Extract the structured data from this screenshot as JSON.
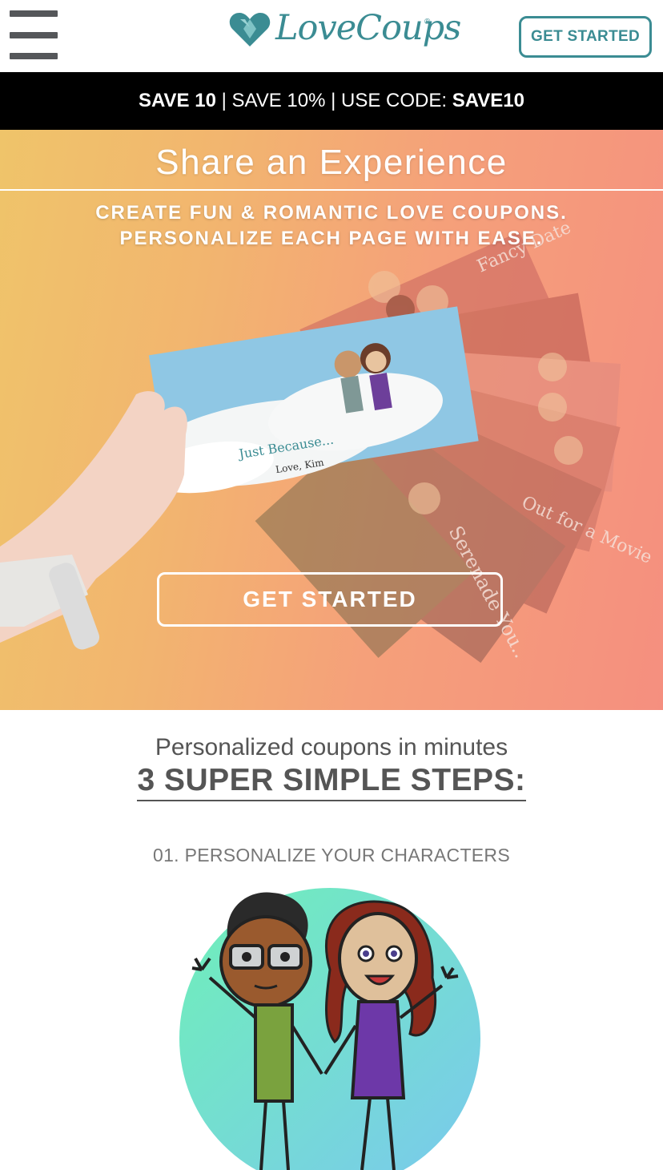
{
  "header": {
    "menu_icon": "hamburger-menu-icon",
    "logo_icon": "heart-logo-icon",
    "logo_text": "LoveCoups",
    "logo_reg": "®",
    "cta_label": "GET STARTED",
    "brand_color": "#3b8c93"
  },
  "promo": {
    "part1": "SAVE 10",
    "sep1": " | SAVE 10% | USE CODE: ",
    "code": "SAVE10"
  },
  "hero": {
    "title": "Share an Experience",
    "subtitle_line1": "CREATE FUN & ROMANTIC LOVE COUPONS.",
    "subtitle_line2": "PERSONALIZE EACH PAGE WITH EASE.",
    "card_text": "Just Because...",
    "card_sign": "Love, Kim",
    "coupon_fancy": "Fancy Date",
    "coupon_movie": "Out for a Movie",
    "coupon_serenade": "Serenade You..",
    "cta_label": "GET STARTED"
  },
  "steps": {
    "tagline": "Personalized coupons in minutes",
    "heading": "3 SUPER SIMPLE STEPS:",
    "step1_label": "01. PERSONALIZE YOUR CHARACTERS",
    "step1_illustration": "couple-characters-illustration"
  }
}
